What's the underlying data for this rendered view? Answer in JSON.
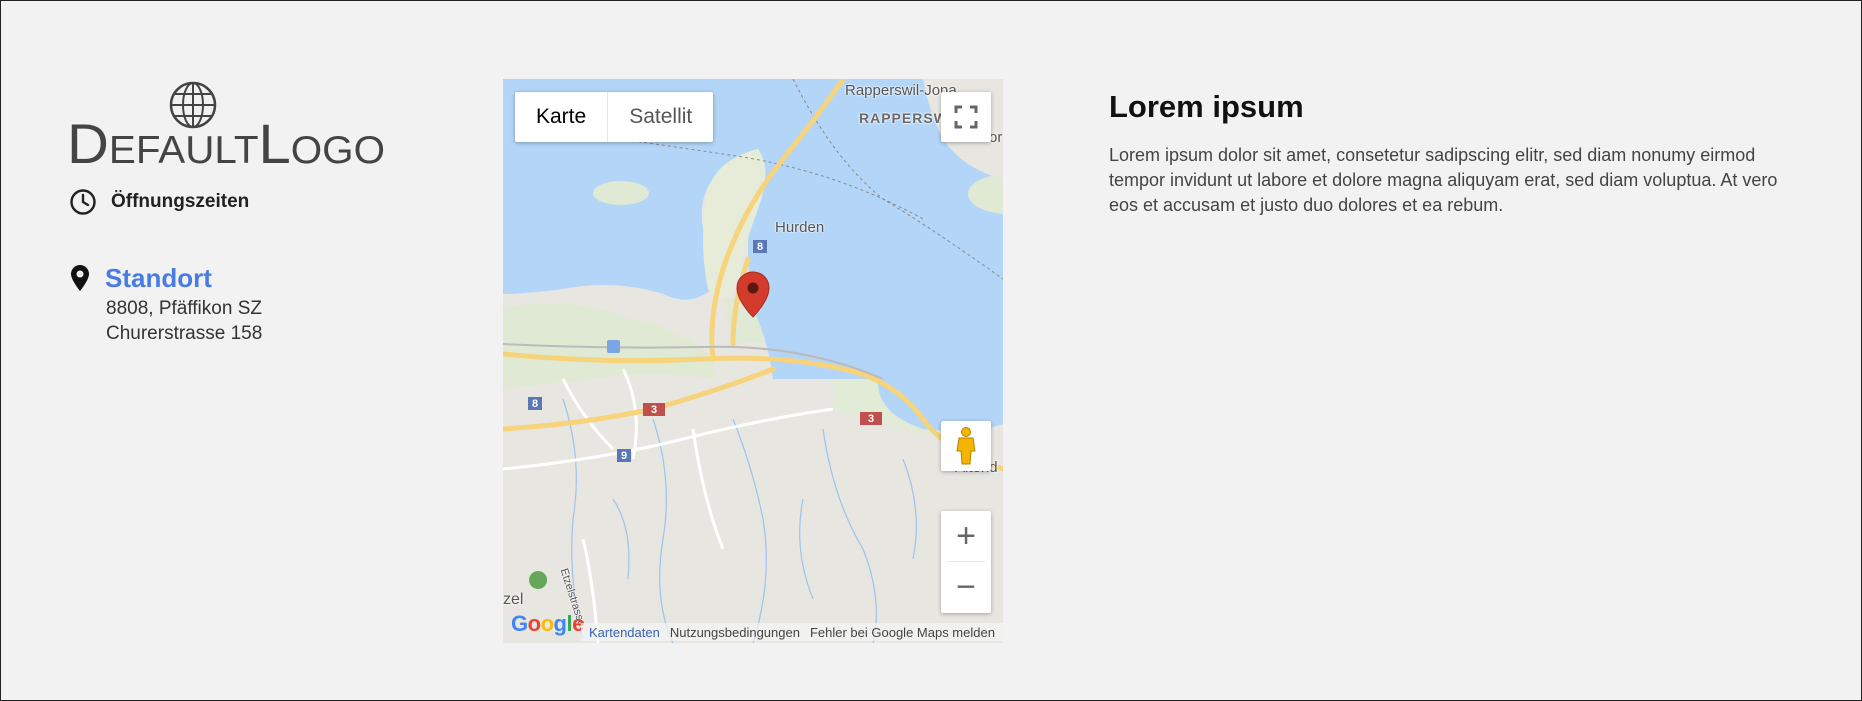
{
  "logo": {
    "text": "DefaultLogo"
  },
  "hours": {
    "icon": "clock-icon",
    "label": "Öffnungszeiten"
  },
  "location": {
    "icon": "map-pin-icon",
    "title": "Standort",
    "address_line1": "8808, Pfäffikon SZ",
    "address_line2": "Churerstrasse 158"
  },
  "map": {
    "type_buttons": {
      "map": "Karte",
      "satellite": "Satellit"
    },
    "selected_type": "Karte",
    "labels": {
      "top_town": "Rapperswil-Jona",
      "top_town_bold": "RAPPERSW",
      "town_mid": "Hurden",
      "town_right": "Altend",
      "street": "Etzelstrasse",
      "bottom_left": "zel",
      "top_right_fragment": "or"
    },
    "road_badges": [
      "8",
      "3",
      "3",
      "8",
      "9"
    ],
    "google_logo": "Google",
    "attribution": {
      "data": "Kartendaten",
      "terms": "Nutzungsbedingungen",
      "report": "Fehler bei Google Maps melden"
    },
    "zoom_in": "+",
    "zoom_out": "−",
    "colors": {
      "water": "#b3d5f7",
      "land": "#e8e6e1",
      "highway": "#f7d37b",
      "marker": "#d33b2c"
    }
  },
  "content": {
    "title": "Lorem ipsum",
    "body": "Lorem ipsum dolor sit amet, consetetur sadipscing elitr, sed diam nonumy eirmod tempor invidunt ut labore et dolore magna aliquyam erat, sed diam voluptua. At vero eos et accusam et justo duo dolores et ea rebum."
  },
  "colors": {
    "background": "#f2f2f2",
    "accent": "#4a7be3"
  }
}
